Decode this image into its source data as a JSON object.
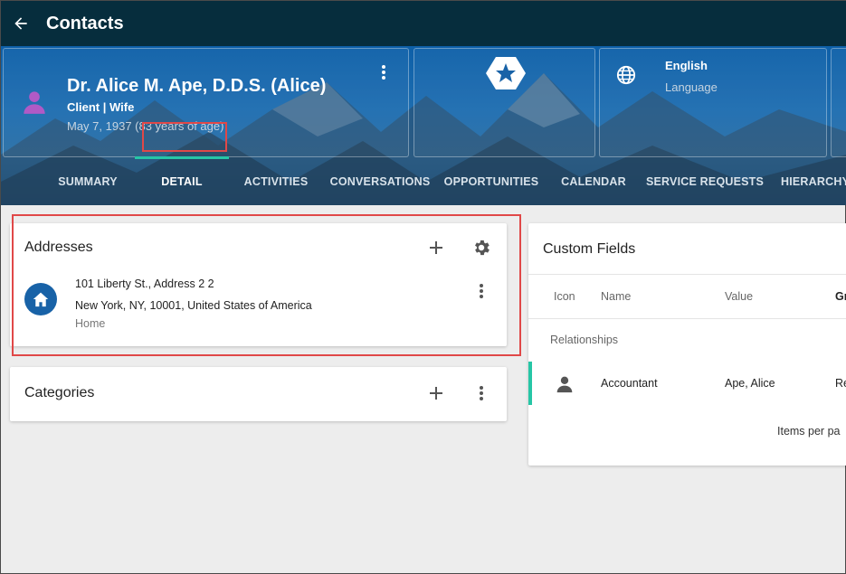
{
  "app": {
    "title": "Contacts"
  },
  "contact": {
    "name": "Dr. Alice M. Ape, D.D.S. (Alice)",
    "role": "Client | Wife",
    "dob": "May 7, 1937 (83 years of age)"
  },
  "language": {
    "value": "English",
    "label": "Language"
  },
  "tabs": [
    {
      "label": "SUMMARY"
    },
    {
      "label": "DETAIL",
      "active": true
    },
    {
      "label": "ACTIVITIES"
    },
    {
      "label": "CONVERSATIONS"
    },
    {
      "label": "OPPORTUNITIES"
    },
    {
      "label": "CALENDAR"
    },
    {
      "label": "SERVICE REQUESTS"
    },
    {
      "label": "HIERARCHY"
    }
  ],
  "addresses": {
    "title": "Addresses",
    "items": [
      {
        "line1": "101 Liberty St., Address 2 2",
        "line2": "New York, NY, 10001, United States of America",
        "type": "Home"
      }
    ]
  },
  "categories": {
    "title": "Categories"
  },
  "custom_fields": {
    "title": "Custom Fields",
    "columns": [
      "Icon",
      "Name",
      "Value",
      "Gr"
    ],
    "group": "Relationships",
    "rows": [
      {
        "name": "Accountant",
        "value": "Ape, Alice",
        "group": "Re"
      }
    ],
    "footer": "Items per pa"
  },
  "colors": {
    "appbar": "#062d3d",
    "accent": "#26c6a6",
    "highlight": "#e04848",
    "address_icon": "#1862a7",
    "avatar": "#b05ac6"
  },
  "icons": {
    "back": "arrow-left-icon",
    "avatar": "person-icon",
    "more": "more-vert-icon",
    "rank": "star-hexagon-icon",
    "language": "globe-icon",
    "add": "plus-icon",
    "settings": "gear-icon",
    "home": "home-icon"
  }
}
